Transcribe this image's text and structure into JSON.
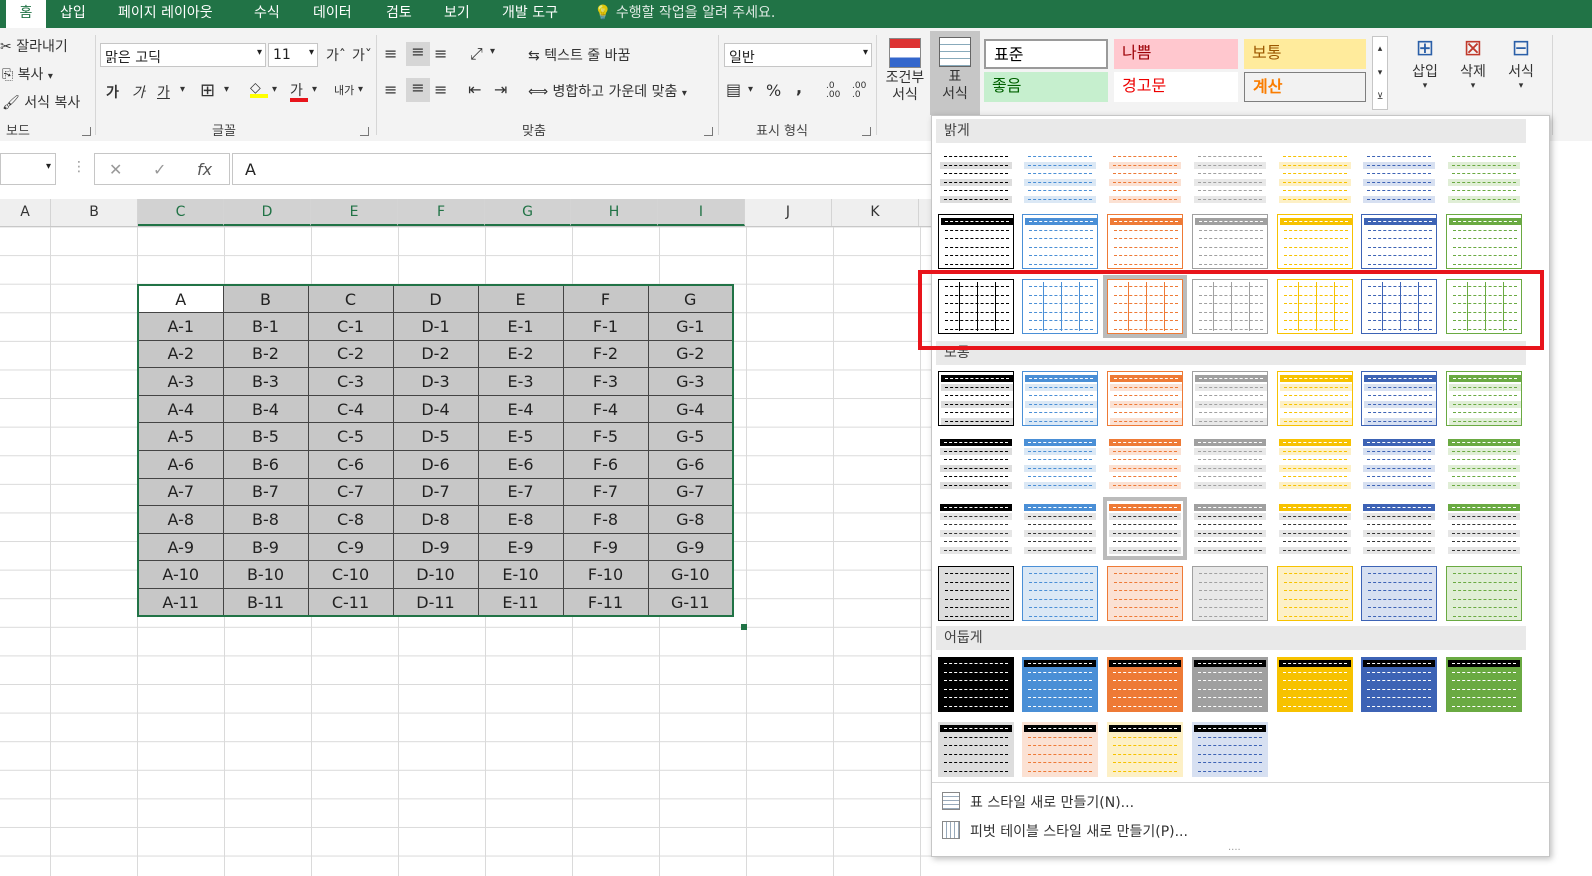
{
  "menu": {
    "tabs": [
      "홈",
      "삽입",
      "페이지 레이아웃",
      "수식",
      "데이터",
      "검토",
      "보기",
      "개발 도구"
    ],
    "tell_me": "수행할 작업을 알려 주세요."
  },
  "clipboard": {
    "cut": "잘라내기",
    "copy": "복사",
    "format_painter": "서식 복사",
    "group": "보드"
  },
  "font": {
    "name": "맑은 고딕",
    "size": "11",
    "bold": "가",
    "italic": "가",
    "underline": "가",
    "font_color_char": "가",
    "group": "글꼴"
  },
  "alignment": {
    "wrap_text": "텍스트 줄 바꿈",
    "merge_center": "병합하고 가운데 맞춤",
    "group": "맞춤",
    "orient": "내가"
  },
  "number": {
    "format": "일반",
    "group": "표시 형식",
    "percent": "%",
    "comma": ",",
    "inc_dec": ".0\n.00",
    "dec_dec": ".00\n.0"
  },
  "styles": {
    "conditional": "조건부\n서식",
    "table": "표\n서식",
    "cells": [
      "표준",
      "나쁨",
      "보통",
      "좋음",
      "경고문",
      "계산"
    ]
  },
  "cells_group": {
    "insert": "삽입",
    "delete": "삭제",
    "format": "서식"
  },
  "formula_bar": {
    "name_box": "",
    "cancel": "✕",
    "enter": "✓",
    "fx": "fx",
    "value": "A"
  },
  "sheet": {
    "columns": [
      "A",
      "B",
      "C",
      "D",
      "E",
      "F",
      "G",
      "H",
      "I",
      "J",
      "K"
    ],
    "selected_columns": [
      "C",
      "D",
      "E",
      "F",
      "G",
      "H",
      "I"
    ],
    "table_header": [
      "A",
      "B",
      "C",
      "D",
      "E",
      "F",
      "G"
    ],
    "table_rows": [
      [
        "A-1",
        "B-1",
        "C-1",
        "D-1",
        "E-1",
        "F-1",
        "G-1"
      ],
      [
        "A-2",
        "B-2",
        "C-2",
        "D-2",
        "E-2",
        "F-2",
        "G-2"
      ],
      [
        "A-3",
        "B-3",
        "C-3",
        "D-3",
        "E-3",
        "F-3",
        "G-3"
      ],
      [
        "A-4",
        "B-4",
        "C-4",
        "D-4",
        "E-4",
        "F-4",
        "G-4"
      ],
      [
        "A-5",
        "B-5",
        "C-5",
        "D-5",
        "E-5",
        "F-5",
        "G-5"
      ],
      [
        "A-6",
        "B-6",
        "C-6",
        "D-6",
        "E-6",
        "F-6",
        "G-6"
      ],
      [
        "A-7",
        "B-7",
        "C-7",
        "D-7",
        "E-7",
        "F-7",
        "G-7"
      ],
      [
        "A-8",
        "B-8",
        "C-8",
        "D-8",
        "E-8",
        "F-8",
        "G-8"
      ],
      [
        "A-9",
        "B-9",
        "C-9",
        "D-9",
        "E-9",
        "F-9",
        "G-9"
      ],
      [
        "A-10",
        "B-10",
        "C-10",
        "D-10",
        "E-10",
        "F-10",
        "G-10"
      ],
      [
        "A-11",
        "B-11",
        "C-11",
        "D-11",
        "E-11",
        "F-11",
        "G-11"
      ]
    ]
  },
  "gallery": {
    "sections": {
      "light": "밝게",
      "medium": "보통",
      "dark": "어둡게"
    },
    "new_table_style": "표 스타일 새로 만들기(N)...",
    "new_pivot_style": "피벗 테이블 스타일 새로 만들기(P)...",
    "palette": [
      "#000000",
      "#4a8fd6",
      "#ee7a36",
      "#a0a0a0",
      "#f7c200",
      "#3d63b5",
      "#6aaa42"
    ],
    "palette_light": [
      "#dddddd",
      "#dbe8f5",
      "#fbe1d3",
      "#e8e8e8",
      "#fdf0c6",
      "#d7e0f1",
      "#e0eed6"
    ]
  },
  "colors": {
    "excel_green": "#217346",
    "highlight_red": "#e8141b"
  }
}
